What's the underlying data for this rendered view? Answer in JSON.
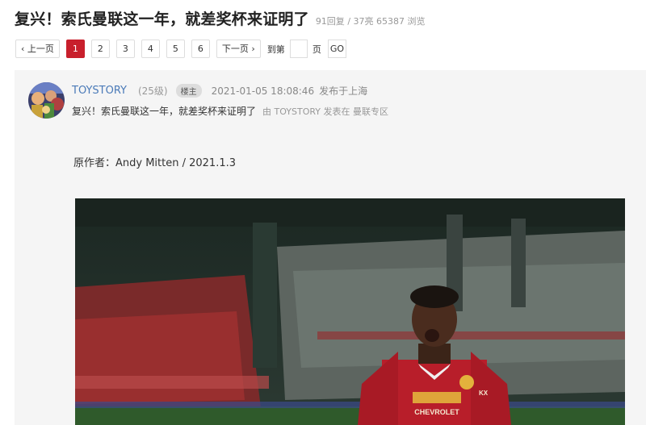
{
  "title": "复兴！索氏曼联这一年，就差奖杯来证明了",
  "stats": {
    "replies": "91回复",
    "separator": "/",
    "likes": "37亮",
    "views": "65387 浏览"
  },
  "pagination": {
    "prev_label": "上一页",
    "pages": [
      "1",
      "2",
      "3",
      "4",
      "5",
      "6"
    ],
    "current_page": "1",
    "next_label": "下一页",
    "goto_prefix": "到第",
    "goto_suffix": "页",
    "go_label": "GO"
  },
  "post": {
    "author": "TOYSTORY",
    "level": "(25级)",
    "role_badge": "楼主",
    "time": "2021-01-05 18:08:46",
    "location": "发布于上海",
    "subject": "复兴！索氏曼联这一年，就差奖杯来证明了",
    "by_label": "由",
    "by_author": "TOYSTORY",
    "posted_in_label": "发表在",
    "board": "曼联专区",
    "original_author_line": "原作者：Andy Mitten / 2021.1.3"
  },
  "photo": {
    "jersey_text": "CHEVROLET",
    "kit_brand": "KX"
  },
  "colors": {
    "accent": "#c81f2c",
    "author_link": "#4a7ab8"
  },
  "icons": {
    "prev": "chevron-left-icon",
    "next": "chevron-right-icon"
  }
}
